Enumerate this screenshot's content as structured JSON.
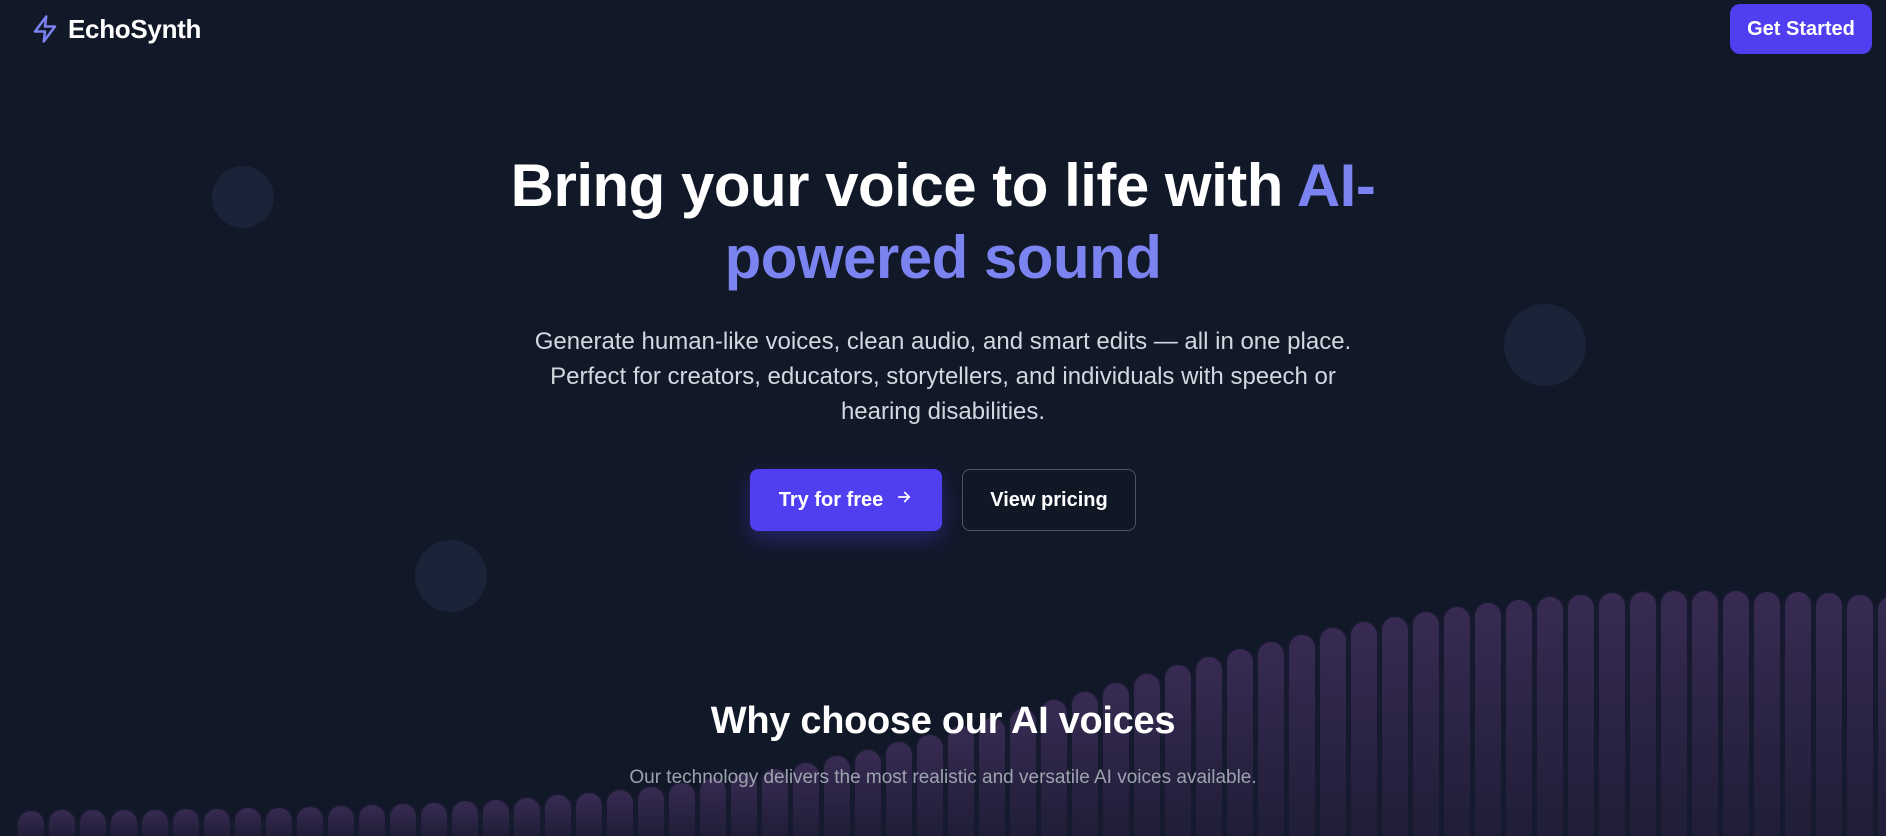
{
  "brand": {
    "name": "EchoSynth",
    "icon": "lightning-icon",
    "icon_color": "#7b83f0"
  },
  "header": {
    "cta_label": "Get Started"
  },
  "hero": {
    "title_main": "Bring your voice to life with ",
    "title_accent": "AI-powered sound",
    "subtitle": "Generate human-like voices, clean audio, and smart edits — all in one place. Perfect for creators, educators, storytellers, and individuals with speech or hearing disabilities.",
    "primary_label": "Try for free",
    "primary_icon": "arrow-right-icon",
    "secondary_label": "View pricing"
  },
  "why": {
    "title": "Why choose our AI voices",
    "subtitle": "Our technology delivers the most realistic and versatile AI voices available."
  },
  "colors": {
    "background": "#111827",
    "accent": "#7b83f0",
    "primary_button": "#4f3ff0",
    "muted_text": "#9ca3af"
  }
}
